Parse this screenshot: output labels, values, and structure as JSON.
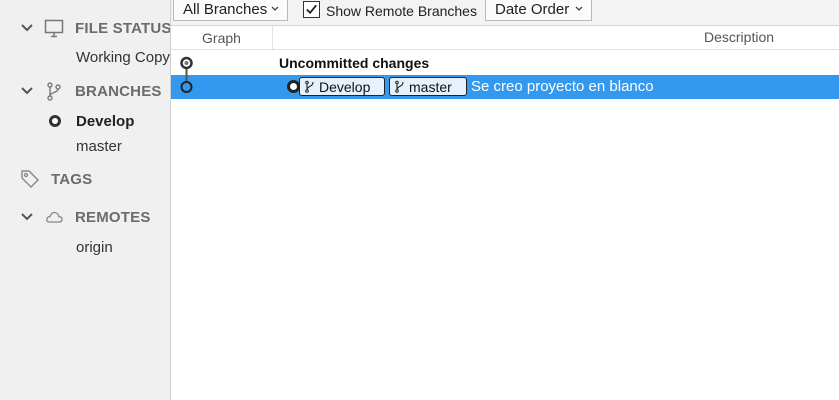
{
  "sidebar": {
    "file_status": {
      "title": "FILE STATUS",
      "items": [
        "Working Copy"
      ]
    },
    "branches": {
      "title": "BRANCHES",
      "items": [
        "Develop",
        "master"
      ],
      "current": "Develop"
    },
    "tags": {
      "title": "TAGS"
    },
    "remotes": {
      "title": "REMOTES",
      "items": [
        "origin"
      ]
    }
  },
  "toolbar": {
    "branch_filter": "All Branches",
    "show_remote_label": "Show Remote Branches",
    "show_remote_checked": true,
    "order": "Date Order"
  },
  "columns": {
    "graph": "Graph",
    "description": "Description"
  },
  "rows": [
    {
      "label": "Uncommitted changes"
    },
    {
      "branches": [
        "Develop",
        "master"
      ],
      "message": "Se creo proyecto en blanco"
    }
  ],
  "colors": {
    "selection": "#3399ee",
    "sidebar_bg": "#f0f0f0",
    "badge_bg": "#e6f1fb"
  },
  "icons": [
    "chevron-down-icon",
    "monitor-icon",
    "branch-icon",
    "tag-icon",
    "cloud-icon",
    "checkmark-icon"
  ]
}
